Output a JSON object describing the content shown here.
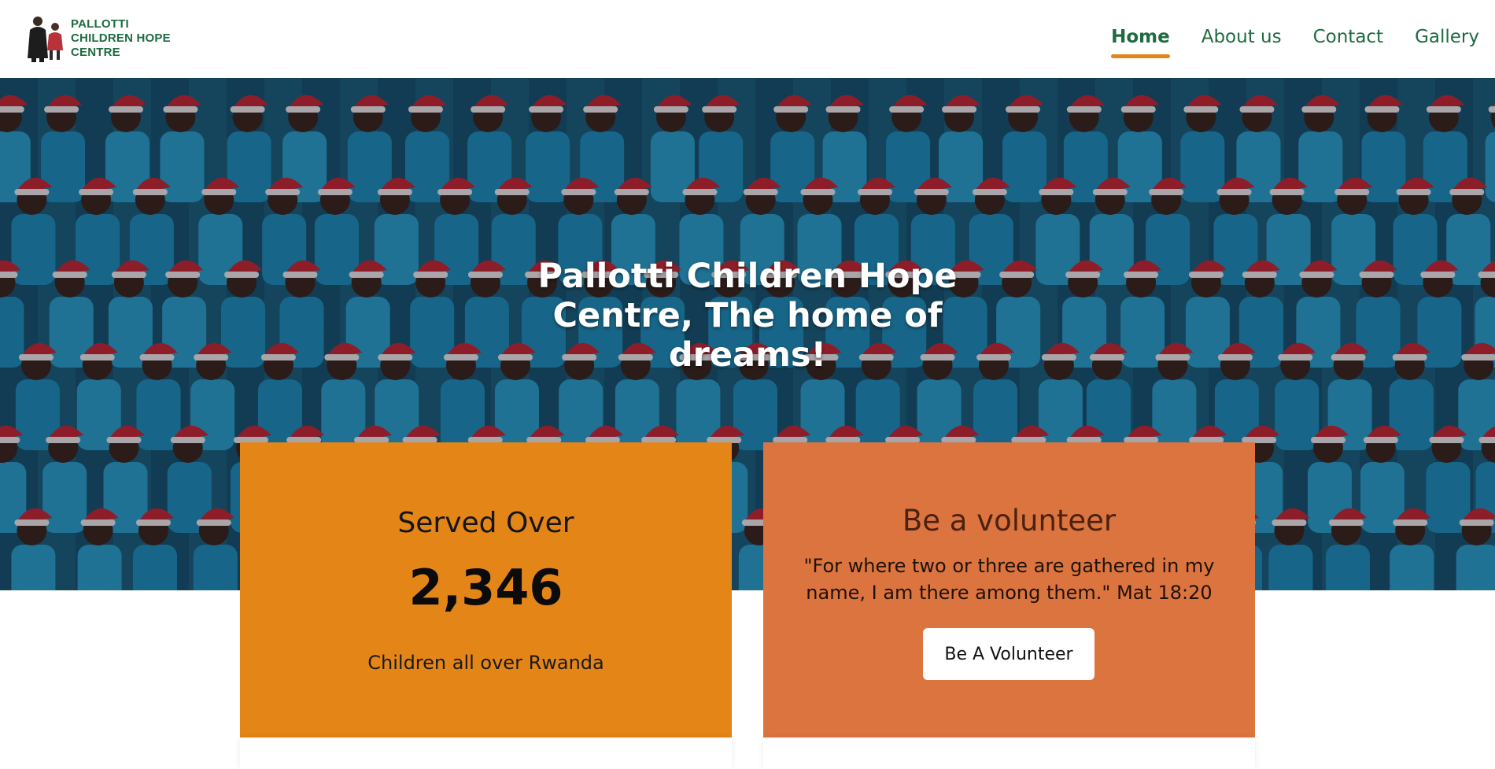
{
  "brand": {
    "line1": "PALLOTTI",
    "line2": "CHILDREN HOPE",
    "line3": "CENTRE",
    "color": "#1e6b3f"
  },
  "nav": {
    "items": [
      {
        "label": "Home",
        "active": true
      },
      {
        "label": "About us",
        "active": false
      },
      {
        "label": "Contact",
        "active": false
      },
      {
        "label": "Gallery",
        "active": false
      }
    ],
    "accent": "#e3861a"
  },
  "hero": {
    "title": "Pallotti Children Hope Centre, The home of dreams!"
  },
  "served_card": {
    "heading": "Served Over",
    "number": "2,346",
    "subtext": "Children all over Rwanda",
    "color": "#e48517"
  },
  "volunteer_card": {
    "heading": "Be a volunteer",
    "quote": "\"For where two or three are gathered in my name, I am there among them.\" Mat 18:20",
    "button_label": "Be A Volunteer",
    "color": "#dc7440"
  }
}
